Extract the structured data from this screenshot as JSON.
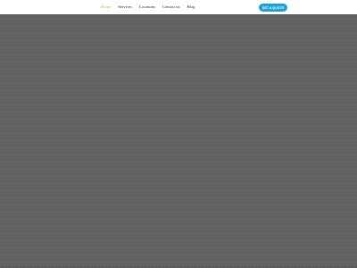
{
  "nav": {
    "items": [
      {
        "label": "Home",
        "active": true
      },
      {
        "label": "Services",
        "active": false
      },
      {
        "label": "Locations",
        "active": false
      },
      {
        "label": "Contact us",
        "active": false
      },
      {
        "label": "Blog",
        "active": false
      }
    ]
  },
  "cta": {
    "label": "GET A QUOTE"
  },
  "colors": {
    "active_nav": "#b3c42f",
    "cta_background": "#1ea6e0",
    "overlay": "#5f5f5f"
  }
}
